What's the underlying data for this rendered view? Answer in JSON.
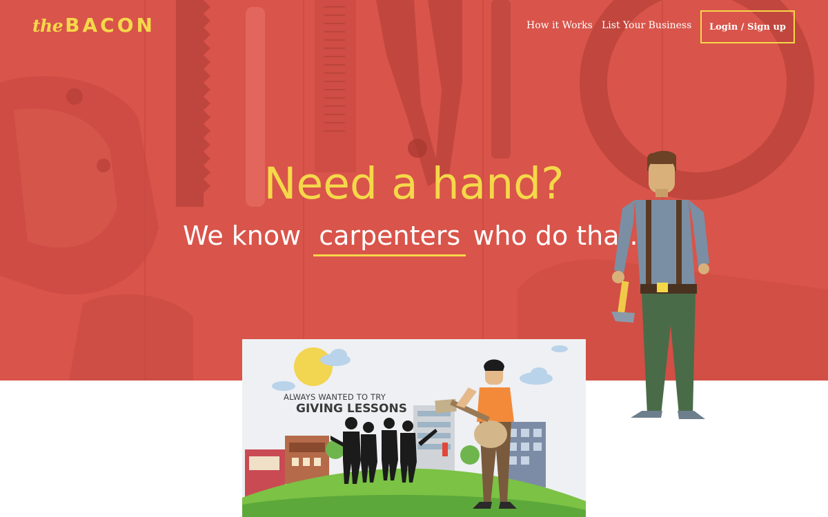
{
  "brand": {
    "prefix": "the",
    "name": "BACON"
  },
  "nav": {
    "how_it_works": "How it Works",
    "list_business": "List Your Business",
    "login": "Login / Sign up"
  },
  "hero": {
    "headline": "Need a hand?",
    "sub_before": "We know",
    "sub_keyword": "carpenters",
    "sub_after": "who do that."
  },
  "video": {
    "line1": "ALWAYS WANTED TO TRY",
    "line2": "GIVING LESSONS"
  },
  "colors": {
    "hero_red": "#d9544a",
    "accent_yellow": "#f5d84a",
    "white": "#ffffff"
  },
  "icons": [
    "carpenter-illustration",
    "hammer-icon",
    "sun-icon",
    "cloud-icon",
    "guitar-icon"
  ]
}
